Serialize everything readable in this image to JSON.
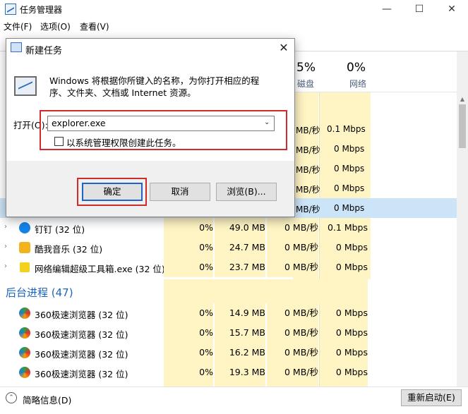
{
  "window": {
    "title": "任务管理器",
    "controls": {
      "minimize": "—",
      "maximize": "☐",
      "close": "✕"
    }
  },
  "menu": [
    "文件(F)",
    "选项(O)",
    "查看(V)"
  ],
  "columns": {
    "disk": {
      "percent": "5%",
      "label": "磁盘"
    },
    "network": {
      "percent": "0%",
      "label": "网络"
    }
  },
  "behind_rows": [
    {
      "disk": "MB/秒",
      "net": "0.1 Mbps"
    },
    {
      "disk": "MB/秒",
      "net": "0 Mbps"
    },
    {
      "disk": "MB/秒",
      "net": "0 Mbps"
    },
    {
      "disk": "MB/秒",
      "net": "0 Mbps"
    },
    {
      "disk": "MB/秒",
      "net": "0 Mbps"
    }
  ],
  "apps": [
    {
      "name": "钉钉 (32 位)",
      "cpu": "0%",
      "mem": "49.0 MB",
      "disk": "0 MB/秒",
      "net": "0.1 Mbps"
    },
    {
      "name": "酷我音乐 (32 位)",
      "cpu": "0%",
      "mem": "24.7 MB",
      "disk": "0 MB/秒",
      "net": "0 Mbps"
    },
    {
      "name": "网络编辑超级工具箱.exe (32 位)",
      "cpu": "0%",
      "mem": "23.7 MB",
      "disk": "0 MB/秒",
      "net": "0 Mbps"
    }
  ],
  "background_group": "后台进程 (47)",
  "background": [
    {
      "name": "360极速浏览器 (32 位)",
      "cpu": "0%",
      "mem": "14.9 MB",
      "disk": "0 MB/秒",
      "net": "0 Mbps"
    },
    {
      "name": "360极速浏览器 (32 位)",
      "cpu": "0%",
      "mem": "15.7 MB",
      "disk": "0 MB/秒",
      "net": "0 Mbps"
    },
    {
      "name": "360极速浏览器 (32 位)",
      "cpu": "0%",
      "mem": "16.2 MB",
      "disk": "0 MB/秒",
      "net": "0 Mbps"
    },
    {
      "name": "360极速浏览器 (32 位)",
      "cpu": "0%",
      "mem": "19.3 MB",
      "disk": "0 MB/秒",
      "net": "0 Mbps"
    }
  ],
  "footer": {
    "fewer_details": "简略信息(D)",
    "restart": "重新启动(E)"
  },
  "dialog": {
    "title": "新建任务",
    "description": "Windows 将根据你所键入的名称，为你打开相应的程序、文件夹、文档或 Internet 资源。",
    "open_label": "打开(O):",
    "open_value": "explorer.exe",
    "admin_checkbox_label": "以系统管理权限创建此任务。",
    "ok": "确定",
    "cancel": "取消",
    "browse": "浏览(B)..."
  },
  "colors": {
    "highlight_red": "#d12c2c",
    "accent_blue": "#1a65c0",
    "column_yellow": "#fff4c4"
  }
}
